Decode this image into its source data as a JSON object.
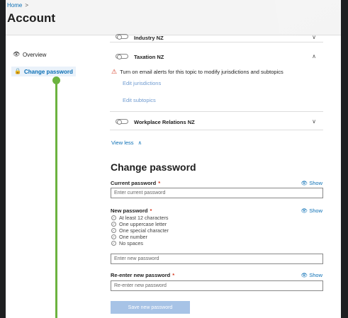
{
  "breadcrumb": {
    "home": "Home",
    "sep": ">"
  },
  "page_title": "Account",
  "sidebar": {
    "items": [
      {
        "label": "Overview",
        "icon": "eye-icon"
      },
      {
        "label": "Change password",
        "icon": "lock-icon"
      }
    ]
  },
  "topics": [
    {
      "label": "Industry NZ",
      "expanded": false
    },
    {
      "label": "Taxation NZ",
      "expanded": true
    },
    {
      "label": "Workplace Relations NZ",
      "expanded": false
    }
  ],
  "warning_text": "Turn on email alerts for this topic to modify jurisdictions and subtopics",
  "edit_jurisdictions": "Edit jurisdictions",
  "edit_subtopics": "Edit subtopics",
  "view_less": "View less",
  "change_password": {
    "heading": "Change password",
    "current_label": "Current password",
    "current_placeholder": "Enter current password",
    "new_label": "New password",
    "new_placeholder": "Enter new password",
    "reenter_label": "Re-enter new password",
    "reenter_placeholder": "Re-enter new password",
    "required_mark": "*",
    "show": "Show",
    "rules": [
      "At least 12 characters",
      "One uppercase letter",
      "One special character",
      "One number",
      "No spaces"
    ],
    "save_label": "Save new password"
  },
  "colors": {
    "accent": "#0b6fb5",
    "progress": "#6cb33f",
    "warning": "#d4351c",
    "button_disabled": "#a7c3e6"
  }
}
